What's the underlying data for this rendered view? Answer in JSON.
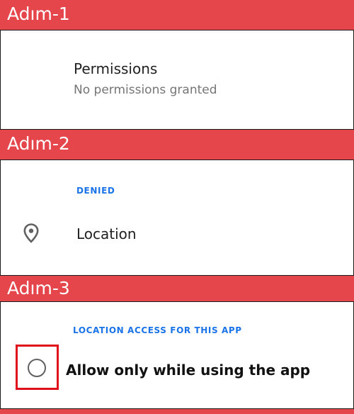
{
  "steps": [
    {
      "label": "Adım-1"
    },
    {
      "label": "Adım-2"
    },
    {
      "label": "Adım-3"
    }
  ],
  "step1": {
    "title": "Permissions",
    "subtitle": "No permissions granted"
  },
  "step2": {
    "section": "DENIED",
    "item": "Location",
    "icon": "location-pin-icon"
  },
  "step3": {
    "section": "LOCATION ACCESS FOR THIS APP",
    "option": "Allow only while using the app",
    "option_selected": false,
    "highlight_color": "#e0101a"
  },
  "colors": {
    "header_bg": "#e5464b",
    "accent": "#1a73e8"
  }
}
